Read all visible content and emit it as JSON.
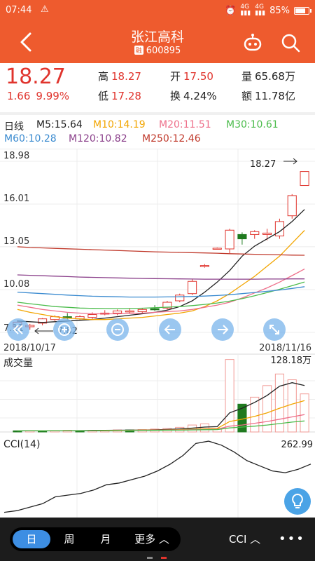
{
  "status": {
    "time": "07:44",
    "battery": "85%",
    "battery_level": 0.85
  },
  "header": {
    "title": "张江高科",
    "badge": "融",
    "code": "600895"
  },
  "quote": {
    "price": "18.27",
    "change": "1.66",
    "change_pct": "9.99%",
    "high_label": "高",
    "high": "18.27",
    "low_label": "低",
    "low": "17.28",
    "open_label": "开",
    "open": "17.50",
    "turnover_label": "换",
    "turnover": "4.24%",
    "volume_label": "量",
    "volume": "65.68万",
    "amount_label": "额",
    "amount": "11.78亿"
  },
  "ma_legend": {
    "period": "日线",
    "items": [
      {
        "text": "M5:15.64",
        "color": "#222222"
      },
      {
        "text": "M10:14.19",
        "color": "#f2a500"
      },
      {
        "text": "M20:11.51",
        "color": "#ee6f8a"
      },
      {
        "text": "M30:10.61",
        "color": "#4cbc4c"
      },
      {
        "text": "M60:10.28",
        "color": "#3b8bd0"
      },
      {
        "text": "M120:10.82",
        "color": "#8a3f8a"
      },
      {
        "text": "M250:12.46",
        "color": "#c0392b"
      }
    ]
  },
  "chart_data": {
    "type": "candlestick",
    "y_ticks": [
      "18.98",
      "16.01",
      "13.05",
      "10.08",
      "7.11"
    ],
    "ylim": [
      7.11,
      18.98
    ],
    "x_start": "2018/10/17",
    "x_end": "2018/11/16",
    "max_marker": "18.27",
    "min_marker": "7.82",
    "candles": [
      {
        "o": 7.5,
        "h": 7.95,
        "l": 7.4,
        "c": 7.82
      },
      {
        "o": 7.5,
        "h": 7.7,
        "l": 7.3,
        "c": 7.6
      },
      {
        "o": 7.75,
        "h": 8.1,
        "l": 7.6,
        "c": 8.05
      },
      {
        "o": 8.0,
        "h": 8.3,
        "l": 7.9,
        "c": 8.2
      },
      {
        "o": 8.2,
        "h": 8.45,
        "l": 8.0,
        "c": 8.1
      },
      {
        "o": 8.05,
        "h": 8.3,
        "l": 7.95,
        "c": 8.2
      },
      {
        "o": 8.15,
        "h": 8.5,
        "l": 8.0,
        "c": 8.35
      },
      {
        "o": 8.4,
        "h": 8.65,
        "l": 8.3,
        "c": 8.45
      },
      {
        "o": 8.45,
        "h": 8.7,
        "l": 8.3,
        "c": 8.6
      },
      {
        "o": 8.55,
        "h": 8.8,
        "l": 8.4,
        "c": 8.6
      },
      {
        "o": 8.55,
        "h": 8.8,
        "l": 8.45,
        "c": 8.7
      },
      {
        "o": 8.75,
        "h": 9.0,
        "l": 8.6,
        "c": 8.7
      },
      {
        "o": 8.8,
        "h": 9.3,
        "l": 8.7,
        "c": 9.2
      },
      {
        "o": 9.3,
        "h": 9.8,
        "l": 9.2,
        "c": 9.7
      },
      {
        "o": 9.8,
        "h": 10.8,
        "l": 9.7,
        "c": 10.65
      },
      {
        "o": 11.75,
        "h": 11.85,
        "l": 11.6,
        "c": 11.75
      },
      {
        "o": 12.95,
        "h": 13.0,
        "l": 12.9,
        "c": 12.95
      },
      {
        "o": 12.9,
        "h": 14.3,
        "l": 12.6,
        "c": 14.2
      },
      {
        "o": 13.9,
        "h": 14.05,
        "l": 13.2,
        "c": 13.6
      },
      {
        "o": 13.9,
        "h": 14.2,
        "l": 13.6,
        "c": 14.1
      },
      {
        "o": 13.9,
        "h": 14.3,
        "l": 13.5,
        "c": 14.0
      },
      {
        "o": 13.8,
        "h": 15.0,
        "l": 13.6,
        "c": 14.8
      },
      {
        "o": 15.2,
        "h": 16.7,
        "l": 15.0,
        "c": 16.6
      },
      {
        "o": 17.3,
        "h": 18.27,
        "l": 17.28,
        "c": 18.27
      }
    ],
    "ma": [
      {
        "name": "M5",
        "color": "#222222",
        "values": [
          7.9,
          7.85,
          7.8,
          7.85,
          7.9,
          7.95,
          8.0,
          8.1,
          8.2,
          8.3,
          8.4,
          8.5,
          8.65,
          8.9,
          9.3,
          9.9,
          10.6,
          11.4,
          12.4,
          13.1,
          13.6,
          14.1,
          14.8,
          15.64
        ]
      },
      {
        "name": "M10",
        "color": "#f2a500",
        "values": [
          8.7,
          8.5,
          8.35,
          8.2,
          8.1,
          8.05,
          8.0,
          8.0,
          8.05,
          8.1,
          8.15,
          8.25,
          8.35,
          8.45,
          8.6,
          8.9,
          9.3,
          9.8,
          10.4,
          11.0,
          11.7,
          12.4,
          13.3,
          14.19
        ]
      },
      {
        "name": "M20",
        "color": "#ee6f8a",
        "values": [
          9.0,
          8.85,
          8.7,
          8.6,
          8.5,
          8.45,
          8.4,
          8.4,
          8.4,
          8.42,
          8.45,
          8.5,
          8.55,
          8.6,
          8.7,
          8.85,
          9.0,
          9.2,
          9.5,
          9.85,
          10.2,
          10.6,
          11.05,
          11.51
        ]
      },
      {
        "name": "M30",
        "color": "#4cbc4c",
        "values": [
          9.2,
          9.1,
          9.0,
          8.9,
          8.85,
          8.8,
          8.78,
          8.77,
          8.76,
          8.77,
          8.79,
          8.82,
          8.86,
          8.9,
          8.97,
          9.05,
          9.15,
          9.28,
          9.45,
          9.65,
          9.87,
          10.1,
          10.35,
          10.61
        ]
      },
      {
        "name": "M60",
        "color": "#3b8bd0",
        "values": [
          9.9,
          9.85,
          9.8,
          9.75,
          9.7,
          9.66,
          9.62,
          9.6,
          9.58,
          9.56,
          9.56,
          9.56,
          9.57,
          9.58,
          9.6,
          9.63,
          9.67,
          9.72,
          9.8,
          9.88,
          9.96,
          10.05,
          10.16,
          10.28
        ]
      },
      {
        "name": "M120",
        "color": "#8a3f8a",
        "values": [
          11.1,
          11.07,
          11.04,
          11.01,
          10.98,
          10.95,
          10.93,
          10.91,
          10.89,
          10.87,
          10.85,
          10.84,
          10.83,
          10.82,
          10.81,
          10.8,
          10.8,
          10.8,
          10.8,
          10.8,
          10.81,
          10.81,
          10.82,
          10.82
        ]
      },
      {
        "name": "M250",
        "color": "#c0392b",
        "values": [
          13.05,
          13.0,
          12.97,
          12.94,
          12.91,
          12.88,
          12.85,
          12.82,
          12.79,
          12.76,
          12.73,
          12.7,
          12.68,
          12.66,
          12.64,
          12.62,
          12.6,
          12.57,
          12.55,
          12.53,
          12.51,
          12.49,
          12.47,
          12.46
        ]
      }
    ],
    "volume": {
      "label": "成交量",
      "max_label": "128.18万",
      "max": 128.18,
      "bars": [
        2,
        2,
        2,
        2.5,
        3,
        2.5,
        3,
        3,
        3.5,
        3.5,
        4,
        5,
        6,
        8,
        12,
        14,
        6,
        125,
        48,
        60,
        80,
        100,
        90,
        65.68
      ],
      "up": [
        false,
        true,
        false,
        true,
        true,
        false,
        true,
        true,
        true,
        false,
        true,
        true,
        true,
        true,
        true,
        true,
        true,
        true,
        false,
        true,
        true,
        true,
        true,
        true
      ],
      "ma": [
        {
          "color": "#222222",
          "values": [
            2,
            2,
            2,
            2.1,
            2.3,
            2.4,
            2.6,
            2.8,
            3,
            3.1,
            3.3,
            3.7,
            4.3,
            5.2,
            6.6,
            8.5,
            9.2,
            33,
            41,
            51,
            63,
            79,
            85,
            80
          ]
        },
        {
          "color": "#f2a500",
          "values": [
            2,
            2,
            2,
            2,
            2,
            2.1,
            2.3,
            2.5,
            2.7,
            2.9,
            3.1,
            3.3,
            3.6,
            4,
            4.7,
            5.6,
            6.1,
            18,
            22,
            27,
            33,
            41,
            48,
            54
          ]
        },
        {
          "color": "#ee6f8a",
          "values": [
            2,
            2,
            2,
            2,
            2,
            2,
            2.1,
            2.3,
            2.5,
            2.7,
            2.9,
            3.1,
            3.3,
            3.6,
            4,
            4.5,
            4.8,
            10,
            12,
            15,
            18,
            22,
            26,
            30
          ]
        },
        {
          "color": "#4cbc4c",
          "values": [
            2,
            2,
            2,
            2,
            2,
            2,
            2,
            2.1,
            2.2,
            2.4,
            2.6,
            2.8,
            3,
            3.2,
            3.5,
            3.9,
            4.1,
            7,
            8.5,
            10,
            12,
            14.5,
            17,
            19
          ]
        }
      ]
    },
    "cci": {
      "label": "CCI(14)",
      "value_label": "262.99",
      "values": [
        -150,
        -140,
        -120,
        -100,
        -60,
        -50,
        -40,
        -20,
        10,
        20,
        40,
        60,
        90,
        130,
        180,
        250,
        262.99,
        240,
        200,
        150,
        120,
        90,
        80,
        100,
        130
      ]
    }
  },
  "tabs": {
    "day": "日",
    "week": "周",
    "month": "月",
    "more": "更多"
  },
  "bottom": {
    "indicator": "CCI"
  }
}
